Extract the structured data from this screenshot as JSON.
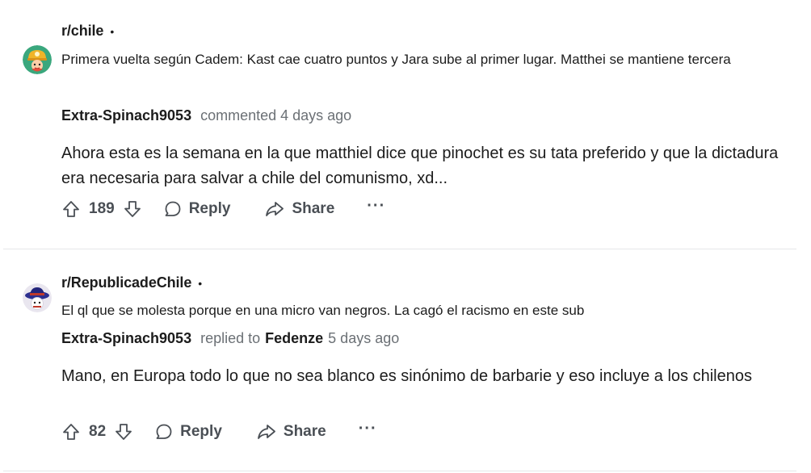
{
  "comments": [
    {
      "subreddit": "r/chile",
      "separator": "•",
      "post_title": "Primera vuelta según Cadem: Kast cae cuatro puntos y Jara sube al primer lugar. Matthei se mantiene tercera",
      "author": "Extra-Spinach9053",
      "action_text": "commented 4 days ago",
      "body": "Ahora esta es la semana en la que matthiel dice que pinochet es su tata preferido y que la dictadura era necesaria para salvar a chile del comunismo, xd...",
      "score": "189",
      "reply_label": "Reply",
      "share_label": "Share",
      "more_label": "···"
    },
    {
      "subreddit": "r/RepublicadeChile",
      "separator": "•",
      "post_title": "El ql que se molesta porque en una micro van negros. La cagó el racismo en este sub",
      "author": "Extra-Spinach9053",
      "action_text": "replied to",
      "reply_target": "Fedenze",
      "time_text": "5 days ago",
      "body": "Mano, en Europa todo lo que no sea blanco es sinónimo de barbarie y eso incluye a los chilenos",
      "score": "82",
      "reply_label": "Reply",
      "share_label": "Share",
      "more_label": "···"
    }
  ],
  "icons": {
    "avatar_1": "miner-helmet-avatar-icon",
    "avatar_2": "hat-avatar-icon",
    "upvote": "upvote-arrow-icon",
    "downvote": "downvote-arrow-icon",
    "reply": "speech-bubble-icon",
    "share": "share-arrow-icon"
  },
  "colors": {
    "text": "#1c1c1c",
    "muted": "#6b7075",
    "action": "#4a4f55",
    "divider": "#e5e7e9",
    "avatar_1_bg": "#3aa77d",
    "avatar_2_bg": "#e9e6ef"
  }
}
